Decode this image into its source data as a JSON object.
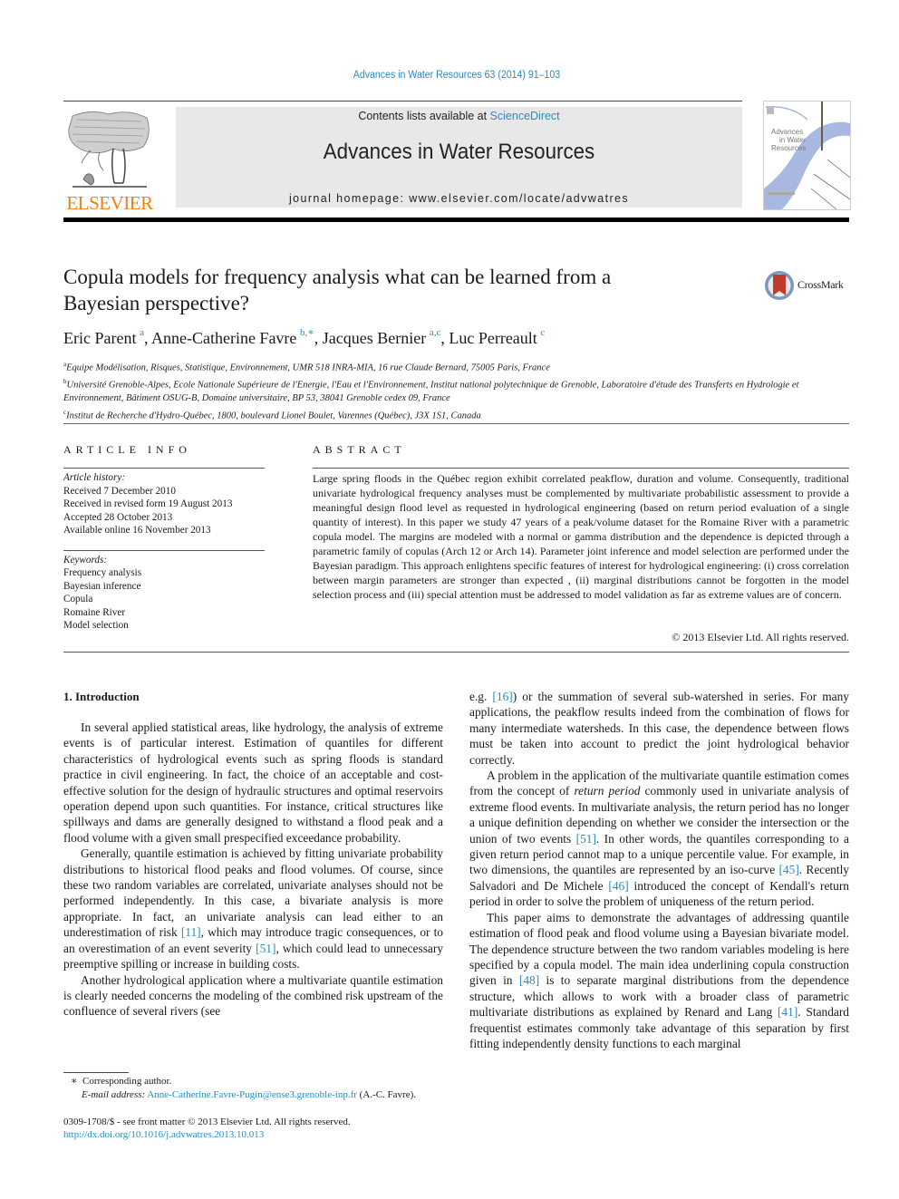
{
  "header": {
    "journal_reference": "Advances in Water Resources 63 (2014) 91–103",
    "contents_prefix": "Contents lists available at ",
    "contents_link": "ScienceDirect",
    "journal_title": "Advances in Water Resources",
    "homepage": "journal homepage: www.elsevier.com/locate/advwatres",
    "publisher_logo_text": "ELSEVIER",
    "cover_text": [
      "Advances",
      "in Water",
      "Resources"
    ],
    "crossmark_label": "CrossMark",
    "colors": {
      "link": "#2a8bbd",
      "elsevier_orange": "#f07f16",
      "band": "#e8e8e8"
    }
  },
  "article": {
    "title": "Copula models for frequency analysis what can be learned from a Bayesian perspective?",
    "authors": [
      {
        "name": "Eric Parent",
        "sup": "a"
      },
      {
        "name": "Anne-Catherine Favre",
        "sup": "b,∗"
      },
      {
        "name": "Jacques Bernier",
        "sup": "a,c"
      },
      {
        "name": "Luc Perreault",
        "sup": "c"
      }
    ],
    "affiliations": [
      {
        "mark": "a",
        "text": "Equipe Modélisation, Risques, Statistique, Environnement, UMR 518 INRA-MIA, 16 rue Claude Bernard, 75005 Paris, France"
      },
      {
        "mark": "b",
        "text": "Université Grenoble-Alpes, Ecole Nationale Supérieure de l'Energie, l'Eau et l'Environnement, Institut national polytechnique de Grenoble, Laboratoire d'étude des Transferts en Hydrologie et Environnement, Bâtiment OSUG-B, Domaine universitaire, BP 53, 38041 Grenoble cedex 09, France"
      },
      {
        "mark": "c",
        "text": "Institut de Recherche d'Hydro-Québec, 1800, boulevard Lionel Boulet, Varennes (Québec), J3X 1S1, Canada"
      }
    ]
  },
  "article_info": {
    "heading": "ARTICLE INFO",
    "history_label": "Article history:",
    "history": [
      "Received 7 December 2010",
      "Received in revised form 19 August 2013",
      "Accepted 28 October 2013",
      "Available online 16 November 2013"
    ],
    "keywords_label": "Keywords:",
    "keywords": [
      "Frequency analysis",
      "Bayesian inference",
      "Copula",
      "Romaine River",
      "Model selection"
    ]
  },
  "abstract": {
    "heading": "ABSTRACT",
    "text": "Large spring floods in the Québec region exhibit correlated peakflow, duration and volume. Consequently, traditional univariate hydrological frequency analyses must be complemented by multivariate probabilistic assessment to provide a meaningful design flood level as requested in hydrological engineering (based on return period evaluation of a single quantity of interest). In this paper we study 47 years of a peak/volume dataset for the Romaine River with a parametric copula model. The margins are modeled with a normal or gamma distribution and the dependence is depicted through a parametric family of copulas (Arch 12 or Arch 14). Parameter joint inference and model selection are performed under the Bayesian paradigm. This approach enlightens specific features of interest for hydrological engineering: (i) cross correlation between margin parameters are stronger than expected , (ii) marginal distributions cannot be forgotten in the model selection process and (iii) special attention must be addressed to model validation as far as extreme values are of concern.",
    "copyright": "© 2013 Elsevier Ltd. All rights reserved."
  },
  "body": {
    "section_heading": "1. Introduction",
    "left_paragraphs": [
      [
        {
          "t": "In several applied statistical areas, like hydrology, the analysis of extreme events is of particular interest. Estimation of quantiles for different characteristics of hydrological events such as spring floods is standard practice in civil engineering. In fact, the choice of an acceptable and cost-effective solution for the design of hydraulic structures and optimal reservoirs operation depend upon such quantities. For instance, critical structures like spillways and dams are generally designed to withstand a flood peak and a flood volume with a given small prespecified exceedance probability."
        }
      ],
      [
        {
          "t": "Generally, quantile estimation is achieved by fitting univariate probability distributions to historical flood peaks and flood volumes. Of course, since these two random variables are correlated, univariate analyses should not be performed independently. In this case, a bivariate analysis is more appropriate. In fact, an univariate analysis can lead either to an underestimation of risk "
        },
        {
          "c": "[11]"
        },
        {
          "t": ", which may introduce tragic consequences, or to an overestimation of an event severity "
        },
        {
          "c": "[51]"
        },
        {
          "t": ", which could lead to unnecessary preemptive spilling or increase in building costs."
        }
      ],
      [
        {
          "t": "Another hydrological application where a multivariate quantile estimation is clearly needed concerns the modeling of the combined risk upstream of the confluence of several rivers (see"
        }
      ]
    ],
    "right_paragraphs": [
      [
        {
          "t": "e.g. "
        },
        {
          "c": "[16]"
        },
        {
          "t": ") or the summation of several sub-watershed in series. For many applications, the peakflow results indeed from the combination of flows for many intermediate watersheds. In this case, the dependence between flows must be taken into account to predict the joint hydrological behavior correctly."
        }
      ],
      [
        {
          "t": "A problem in the application of the multivariate quantile estimation comes from the concept of "
        },
        {
          "i": "return period"
        },
        {
          "t": " commonly used in univariate analysis of extreme flood events. In multivariate analysis, the return period has no longer a unique definition depending on whether we consider the intersection or the union of two events "
        },
        {
          "c": "[51]"
        },
        {
          "t": ". In other words, the quantiles corresponding to a given return period cannot map to a unique percentile value. For example, in two dimensions, the quantiles are represented by an iso-curve "
        },
        {
          "c": "[45]"
        },
        {
          "t": ". Recently Salvadori and De Michele "
        },
        {
          "c": "[46]"
        },
        {
          "t": " introduced the concept of Kendall's return period in order to solve the problem of uniqueness of the return period."
        }
      ],
      [
        {
          "t": "This paper aims to demonstrate the advantages of addressing quantile estimation of flood peak and flood volume using a Bayesian bivariate model. The dependence structure between the two random variables modeling is here specified by a copula model. The main idea underlining copula construction given in "
        },
        {
          "c": "[48]"
        },
        {
          "t": " is to separate marginal distributions from the dependence structure, which allows to work with a broader class of parametric multivariate distributions as explained by Renard and Lang "
        },
        {
          "c": "[41]"
        },
        {
          "t": ". Standard frequentist estimates commonly take advantage of this separation by first fitting independently density functions to each marginal"
        }
      ]
    ]
  },
  "footnotes": {
    "corresponding_mark": "∗",
    "corresponding_text": "Corresponding author.",
    "email_label": "E-mail address:",
    "email": "Anne-Catherine.Favre-Pugin@ense3.grenoble-inp.fr",
    "email_suffix": " (A.-C. Favre).",
    "issn_line": "0309-1708/$ - see front matter © 2013 Elsevier Ltd. All rights reserved.",
    "doi": "http://dx.doi.org/10.1016/j.advwatres.2013.10.013"
  }
}
